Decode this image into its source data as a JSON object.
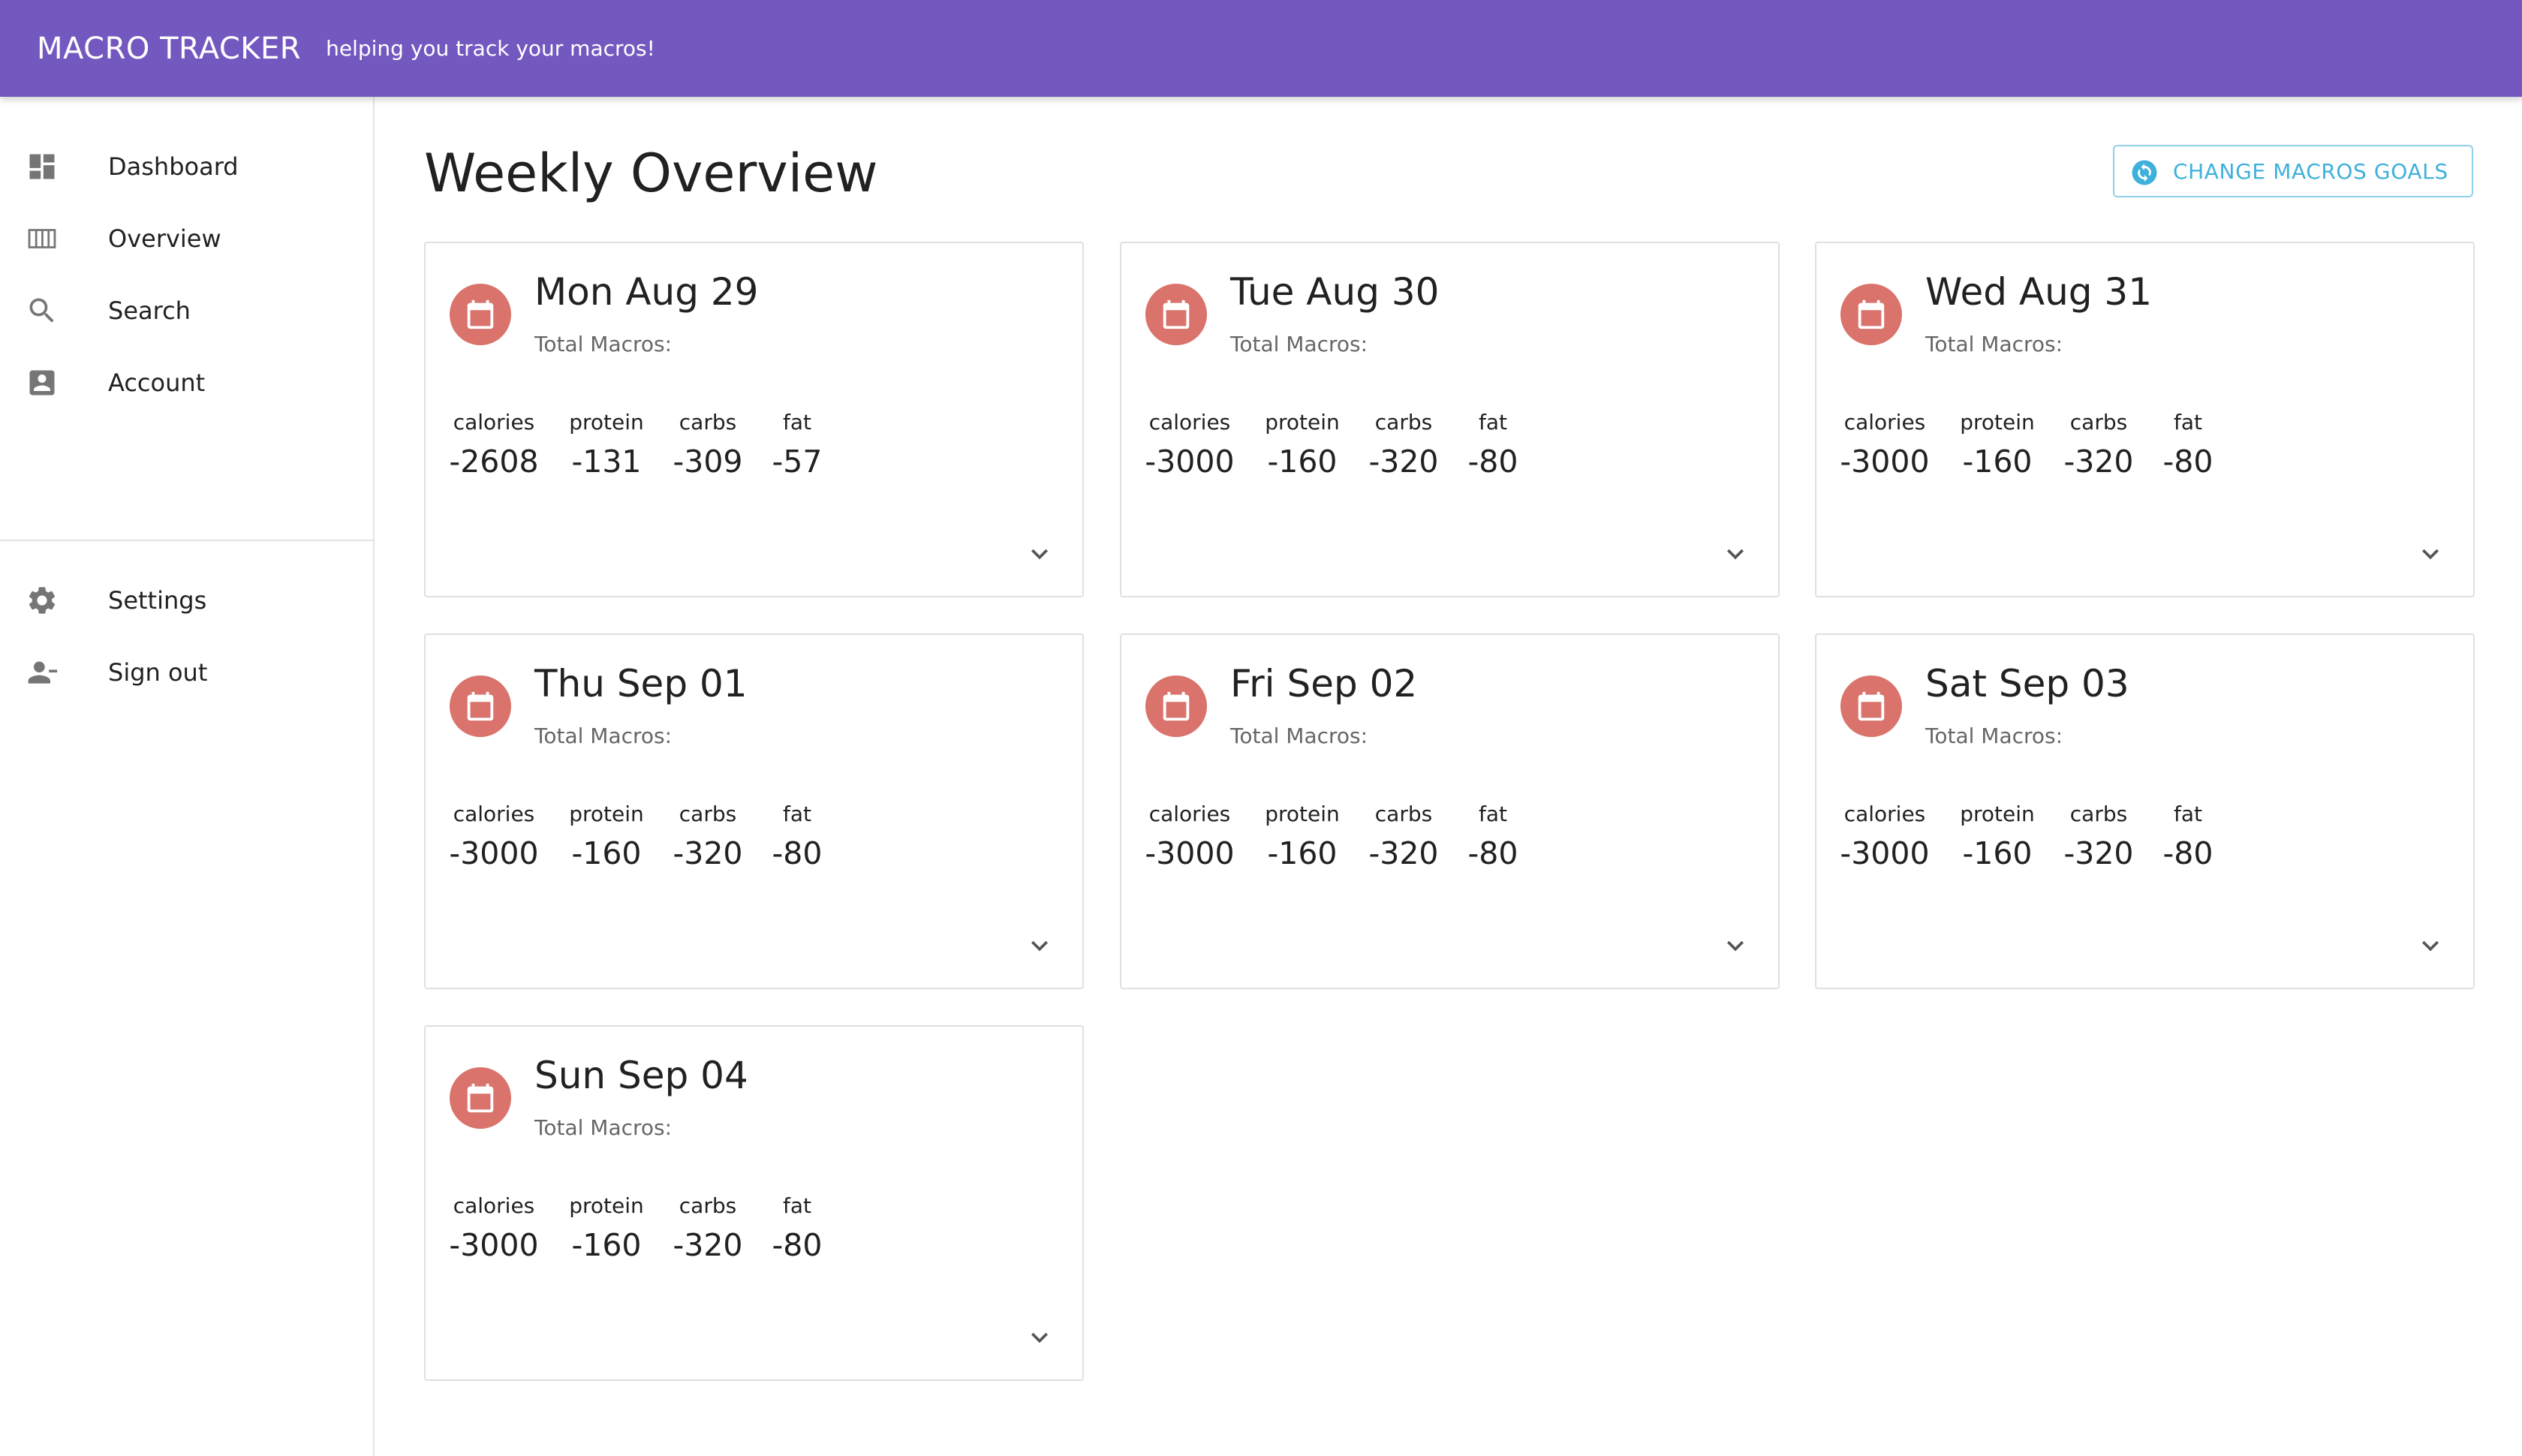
{
  "header": {
    "title": "MACRO TRACKER",
    "subtitle": "helping you track your macros!",
    "color": "#7358c0"
  },
  "sidebar": {
    "primary": [
      {
        "label": "Dashboard",
        "icon": "dashboard-icon"
      },
      {
        "label": "Overview",
        "icon": "view-week-icon"
      },
      {
        "label": "Search",
        "icon": "search-icon"
      },
      {
        "label": "Account",
        "icon": "account-box-icon"
      }
    ],
    "secondary": [
      {
        "label": "Settings",
        "icon": "gear-icon"
      },
      {
        "label": "Sign out",
        "icon": "person-remove-icon"
      }
    ]
  },
  "main": {
    "title": "Weekly Overview",
    "goals_button": {
      "label": "CHANGE MACROS GOALS",
      "icon": "sync-icon",
      "color": "#3fb0db"
    },
    "macro_labels": {
      "calories": "calories",
      "protein": "protein",
      "carbs": "carbs",
      "fat": "fat"
    },
    "days": [
      {
        "title": "Mon Aug 29",
        "subtitle": "Total Macros:",
        "calories": "-2608",
        "protein": "-131",
        "carbs": "-309",
        "fat": "-57"
      },
      {
        "title": "Tue Aug 30",
        "subtitle": "Total Macros:",
        "calories": "-3000",
        "protein": "-160",
        "carbs": "-320",
        "fat": "-80"
      },
      {
        "title": "Wed Aug 31",
        "subtitle": "Total Macros:",
        "calories": "-3000",
        "protein": "-160",
        "carbs": "-320",
        "fat": "-80"
      },
      {
        "title": "Thu Sep 01",
        "subtitle": "Total Macros:",
        "calories": "-3000",
        "protein": "-160",
        "carbs": "-320",
        "fat": "-80"
      },
      {
        "title": "Fri Sep 02",
        "subtitle": "Total Macros:",
        "calories": "-3000",
        "protein": "-160",
        "carbs": "-320",
        "fat": "-80"
      },
      {
        "title": "Sat Sep 03",
        "subtitle": "Total Macros:",
        "calories": "-3000",
        "protein": "-160",
        "carbs": "-320",
        "fat": "-80"
      },
      {
        "title": "Sun Sep 04",
        "subtitle": "Total Macros:",
        "calories": "-3000",
        "protein": "-160",
        "carbs": "-320",
        "fat": "-80"
      }
    ],
    "avatar_color": "#d9736c"
  }
}
